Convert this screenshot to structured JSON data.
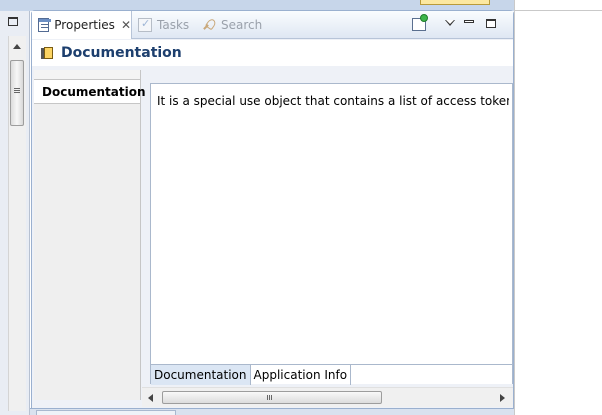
{
  "view": {
    "tabs": [
      {
        "label": "Properties",
        "icon": "properties-icon",
        "active": true
      },
      {
        "label": "Tasks",
        "icon": "tasks-icon",
        "active": false
      },
      {
        "label": "Search",
        "icon": "search-icon",
        "active": false
      }
    ],
    "toolbar": {
      "pin_icon": "pin-icon",
      "menu_icon": "view-menu-icon",
      "minimize_icon": "minimize-icon",
      "maximize_icon": "maximize-icon"
    }
  },
  "section": {
    "title": "Documentation"
  },
  "left_tabs": {
    "items": [
      "Documentation"
    ]
  },
  "content": {
    "text": "It is a special use object that contains a list of access tokens along with"
  },
  "bottom_tabs": {
    "items": [
      "Documentation",
      "Application Info"
    ],
    "selected": "Documentation"
  },
  "colors": {
    "title_blue": "#1d3f6e",
    "frame_border": "#9ab0cf",
    "tab_gradient_bottom": "#dfe7f3"
  }
}
